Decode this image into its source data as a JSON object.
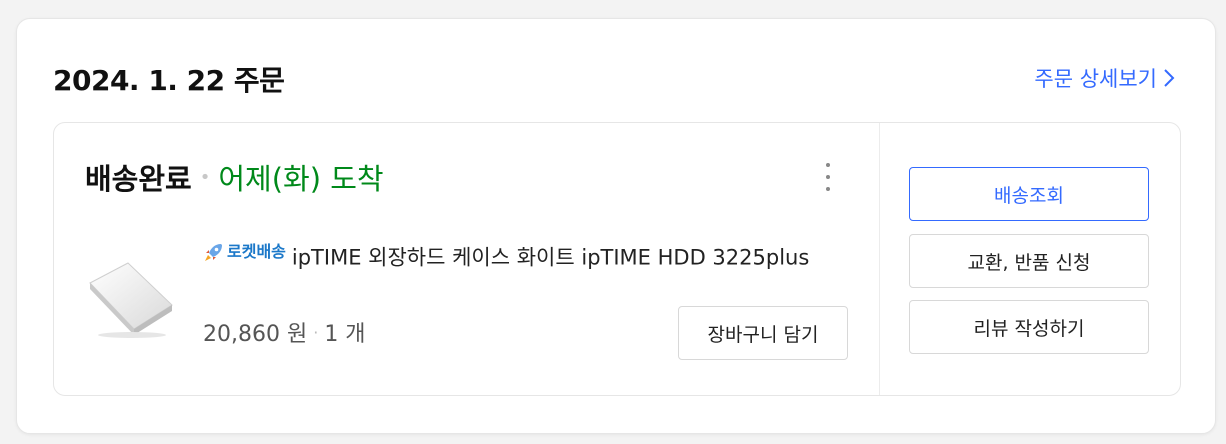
{
  "order": {
    "date_title": "2024. 1. 22 주문",
    "detail_link": "주문 상세보기"
  },
  "shipment": {
    "status": "배송완료",
    "separator": "•",
    "arrival": "어제(화) 도착"
  },
  "product": {
    "badge": "로켓배송",
    "title": "ipTIME 외장하드 케이스 화이트 ipTIME HDD 3225plus",
    "price": "20,860 원",
    "quantity": "1 개",
    "cart_button": "장바구니 담기"
  },
  "actions": {
    "track": "배송조회",
    "exchange_return": "교환, 반품 신청",
    "review": "리뷰 작성하기"
  },
  "colors": {
    "accent": "#346aff",
    "arrival_green": "#00891a",
    "rocket_blue": "#1b78c9"
  },
  "icons": [
    "chevron-right-icon",
    "more-vertical-icon",
    "rocket-icon"
  ]
}
